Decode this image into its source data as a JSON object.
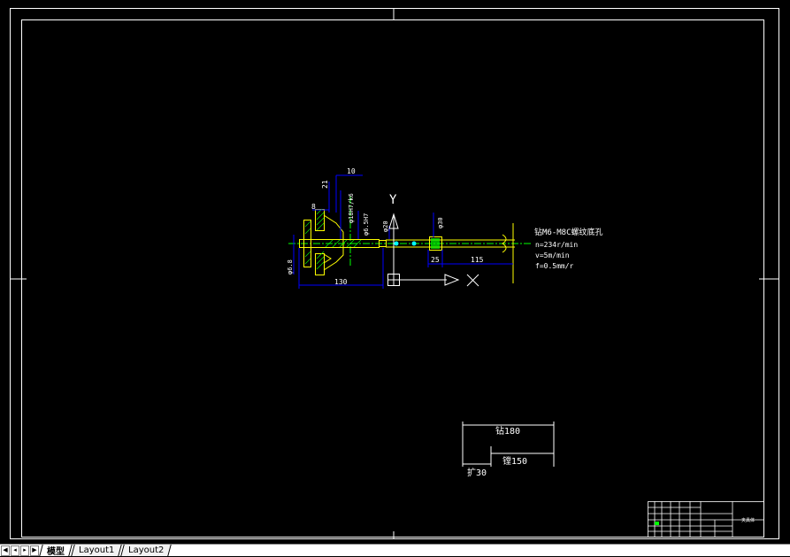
{
  "drawing": {
    "dimensions": {
      "d10": "10",
      "d21": "21",
      "d8": "8",
      "fit_1": "φ18H7/k6",
      "fit_2": "φ6.5H7",
      "phi20": "φ20",
      "phi30": "φ30",
      "phi68": "φ6.8",
      "d130": "130",
      "d25": "25",
      "d115": "115"
    },
    "axes": {
      "y": "Y",
      "x": "X"
    },
    "process": {
      "line1": "钻M6-M8C螺纹底孔",
      "line2": "n=234r/min",
      "line3": "v=5m/min",
      "line4": "f=0.5mm/r"
    },
    "small_dims": {
      "a": "钻180",
      "b": "镗150",
      "c": "扩30"
    },
    "title_block": {
      "name": "夹具体"
    }
  },
  "tabs": {
    "model": "模型",
    "layout1": "Layout1",
    "layout2": "Layout2"
  },
  "colors": {
    "background": "#000000",
    "frame": "#ffffff",
    "dimension": "#0000ff",
    "centerline": "#00ff00",
    "part": "#ffff00",
    "hatch": "#00ff00",
    "text": "#ffffff"
  },
  "icons": {
    "first": "first-tab-icon",
    "prev": "prev-tab-icon",
    "next": "next-tab-icon",
    "last": "last-tab-icon"
  }
}
